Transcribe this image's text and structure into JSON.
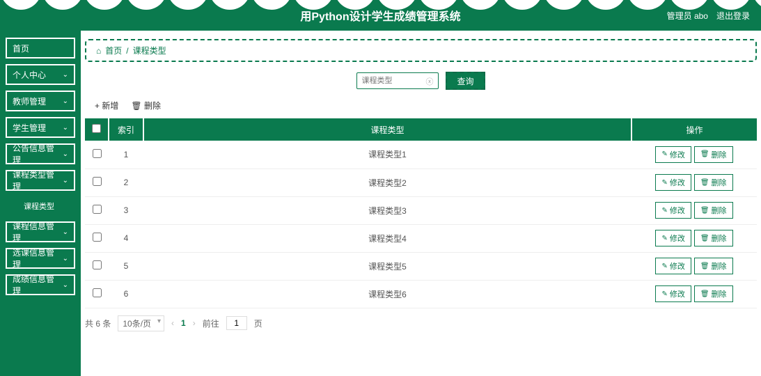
{
  "header": {
    "title": "用Python设计学生成绩管理系统",
    "admin_label": "管理员 abo",
    "logout_label": "退出登录"
  },
  "sidebar": {
    "items": [
      {
        "label": "首页",
        "has_chevron": false
      },
      {
        "label": "个人中心",
        "has_chevron": true
      },
      {
        "label": "教师管理",
        "has_chevron": true
      },
      {
        "label": "学生管理",
        "has_chevron": true
      },
      {
        "label": "公告信息管理",
        "has_chevron": true
      },
      {
        "label": "课程类型管理",
        "has_chevron": true,
        "sub": [
          {
            "label": "课程类型"
          }
        ]
      },
      {
        "label": "课程信息管理",
        "has_chevron": true
      },
      {
        "label": "选课信息管理",
        "has_chevron": true
      },
      {
        "label": "成绩信息管理",
        "has_chevron": true
      }
    ]
  },
  "breadcrumb": {
    "home_icon": "⌂",
    "home_label": "首页",
    "separator": "/",
    "current": "课程类型"
  },
  "search": {
    "placeholder": "课程类型",
    "button_label": "查询"
  },
  "toolbar": {
    "add_label": "新增",
    "delete_label": "删除"
  },
  "table": {
    "columns": {
      "index": "索引",
      "name": "课程类型",
      "ops": "操作"
    },
    "rows": [
      {
        "index": "1",
        "name": "课程类型1"
      },
      {
        "index": "2",
        "name": "课程类型2"
      },
      {
        "index": "3",
        "name": "课程类型3"
      },
      {
        "index": "4",
        "name": "课程类型4"
      },
      {
        "index": "5",
        "name": "课程类型5"
      },
      {
        "index": "6",
        "name": "课程类型6"
      }
    ],
    "ops": {
      "edit": "修改",
      "delete": "删除"
    }
  },
  "pagination": {
    "total_label": "共 6 条",
    "page_size": "10条/页",
    "current": "1",
    "goto_prefix": "前往",
    "goto_value": "1",
    "goto_suffix": "页"
  },
  "icons": {
    "chevron_down": "⌄",
    "plus": "+",
    "trash": "🗑",
    "edit": "✎",
    "prev": "‹",
    "next": "›",
    "clear": "ⓧ"
  }
}
